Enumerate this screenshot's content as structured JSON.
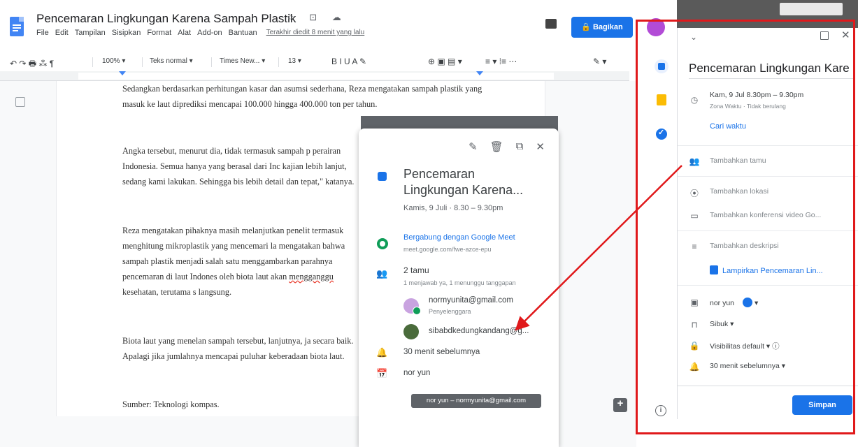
{
  "doc": {
    "title": "Pencemaran Lingkungan Karena Sampah Plastik",
    "title_icons": "☆ ⊡ ☁",
    "menu": [
      "File",
      "Edit",
      "Tampilan",
      "Sisipkan",
      "Format",
      "Alat",
      "Add-on",
      "Bantuan"
    ],
    "last_edit": "Terakhir diedit 8 menit yang lalu",
    "share_label": "🔒 Bagikan",
    "toolbar": {
      "undo_redo": "↶ ↷ 🖶 ⁂ ¶",
      "zoom": "100%  ▾",
      "style": "Teks normal  ▾",
      "font": "Times New...  ▾",
      "size": "13  ▾",
      "format": "B  I  U  A  ✎",
      "insert": "⊕  ▣  ▤ ▾",
      "align": "≡ ▾   ⁞≡   ⋯",
      "edit_mode": "✎ ▾"
    },
    "paragraphs": [
      "Sedangkan berdasarkan perhitungan kasar dan asumsi sederhana, Reza mengatakan sampah plastik yang masuk ke laut diprediksi mencapai 100.000 hingga 400.000 ton per tahun.",
      "Angka tersebut, menurut dia, tidak termasuk sampah p perairan Indonesia. Semua hanya yang berasal dari Inc kajian lebih lanjut, sedang kami lakukan. Sehingga bis lebih detail dan tepat,\" katanya.",
      "Reza mengatakan pihaknya masih melanjutkan penelit termasuk menghitung mikroplastik yang mencemari la mengatakan bahwa sampah plastik menjadi salah satu menggambarkan parahnya pencemaran di laut Indones oleh biota laut akan",
      "Biota laut yang menelan sampah tersebut, lanjutnya, ja secara baik. Apalagi jika jumlahnya mencapai puluhar keberadaan biota laut.",
      "Sumber: Teknologi kompas."
    ],
    "para3_squiggle": "mengganggu",
    "para3_tail": " kesehatan, terutama s langsung."
  },
  "popup": {
    "title": "Pencemaran Lingkungan Karena...",
    "when": "Kamis, 9 Juli  ·  8.30 – 9.30pm",
    "meet_label": "Bergabung dengan Google Meet",
    "meet_url": "meet.google.com/fwe-azce-epu",
    "guests": "2 tamu",
    "guests_sub": "1 menjawab ya, 1 menunggu tanggapan",
    "guest1_email": "normyunita@gmail.com",
    "guest1_role": "Penyelenggara",
    "guest2_email": "sibabdkedungkandang@g...",
    "reminder": "30 menit sebelumnya",
    "calendar": "nor yun",
    "tooltip": "nor yun – normyunita@gmail.com"
  },
  "panel": {
    "title": "Pencemaran Lingkungan Kare",
    "date": "Kam, 9 Jul    8.30pm  –  9.30pm",
    "date_sub": "Zona Waktu · Tidak berulang",
    "find_time": "Cari waktu",
    "add_guests": "Tambahkan tamu",
    "add_location": "Tambahkan lokasi",
    "add_conference": "Tambahkan konferensi video Go...",
    "add_description": "Tambahkan deskripsi",
    "attachment": "Lampirkan Pencemaran Lin...",
    "calendar": "nor yun",
    "busy": "Sibuk  ▾",
    "visibility": "Visibilitas default  ▾",
    "reminder": "30 menit sebelumnya  ▾",
    "save_label": "Simpan"
  },
  "colors": {
    "accent": "#1a73e8",
    "annotation": "#e0191b"
  }
}
